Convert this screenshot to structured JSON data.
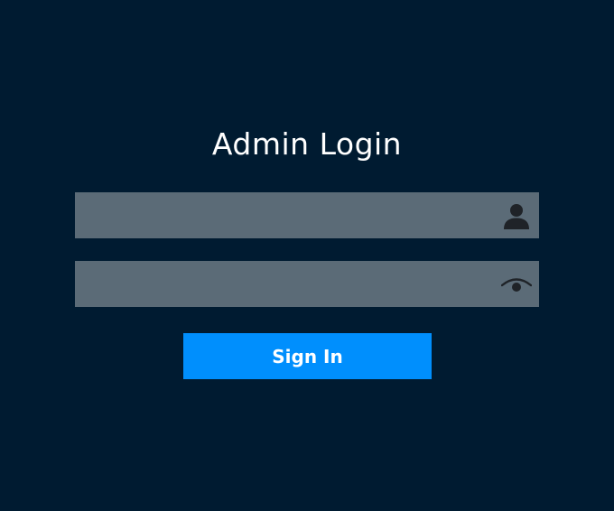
{
  "login": {
    "title": "Admin Login",
    "username": {
      "value": "",
      "placeholder": "",
      "icon": "user-icon"
    },
    "password": {
      "value": "",
      "placeholder": "",
      "icon": "eye-icon"
    },
    "submit_label": "Sign In"
  },
  "colors": {
    "background": "#001b31",
    "field": "#5b6b77",
    "accent": "#008ffd",
    "icon": "#1f2328",
    "text": "#ffffff"
  }
}
